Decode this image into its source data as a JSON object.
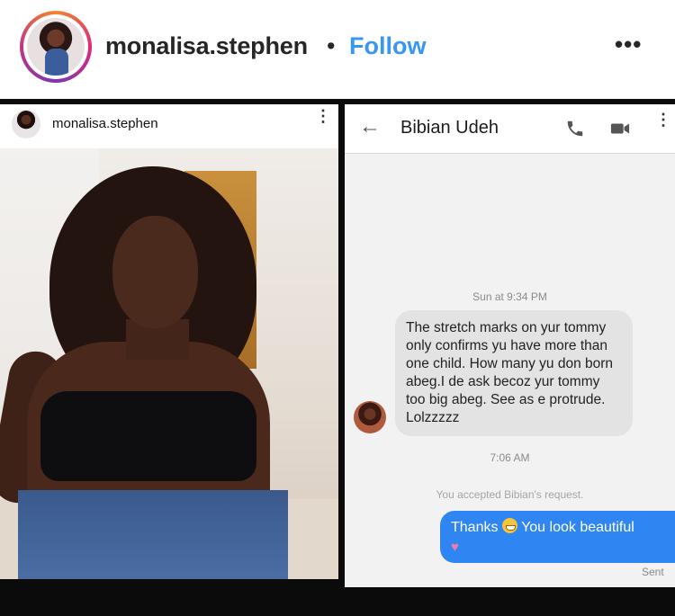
{
  "header": {
    "username": "monalisa.stephen",
    "separator": "•",
    "follow_label": "Follow",
    "more_icon": "more-horizontal-icon",
    "more_glyph": "•••"
  },
  "left_post": {
    "username": "monalisa.stephen",
    "more_glyph": "⋮"
  },
  "chat": {
    "contact_name": "Bibian Udeh",
    "back_glyph": "←",
    "more_glyph": "⋮",
    "timestamp_1": "Sun at 9:34 PM",
    "incoming_message": "The stretch marks on yur tommy only confirms yu have more than one child. How many yu don born abeg.I de ask becoz yur tommy too big abeg. See as e protrude. Lolzzzzz",
    "timestamp_2": "7:06 AM",
    "system_notice": "You accepted Bibian's request.",
    "outgoing_before": "Thanks",
    "outgoing_after": "You look beautiful",
    "heart_glyph": "♥",
    "sent_label": "Sent"
  },
  "colors": {
    "follow_blue": "#3897f0",
    "outgoing_bubble": "#2f86f2",
    "incoming_bubble": "#e3e3e3",
    "frame": "#0b0b0b"
  }
}
